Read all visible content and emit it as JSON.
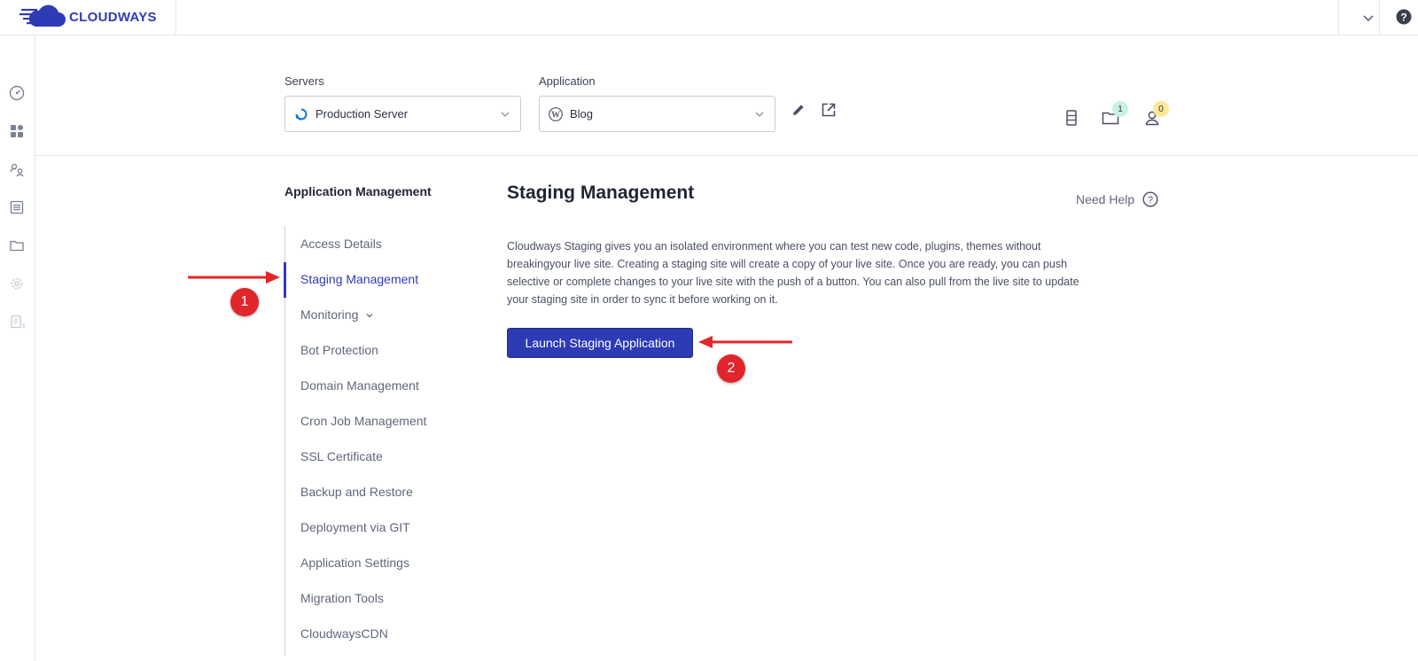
{
  "brand": {
    "name": "CLOUDWAYS"
  },
  "colors": {
    "accent": "#2d3bb5",
    "annotation": "#e0262b"
  },
  "selectors": {
    "servers_label": "Servers",
    "server_value": "Production Server",
    "application_label": "Application",
    "application_value": "Blog"
  },
  "header_icons": {
    "server_count": "",
    "folder_badge": "1",
    "user_badge": "0"
  },
  "sidebar": {
    "title": "Application Management",
    "items": [
      {
        "label": "Access Details"
      },
      {
        "label": "Staging Management"
      },
      {
        "label": "Monitoring"
      },
      {
        "label": "Bot Protection"
      },
      {
        "label": "Domain Management"
      },
      {
        "label": "Cron Job Management"
      },
      {
        "label": "SSL Certificate"
      },
      {
        "label": "Backup and Restore"
      },
      {
        "label": "Deployment via GIT"
      },
      {
        "label": "Application Settings"
      },
      {
        "label": "Migration Tools"
      },
      {
        "label": "CloudwaysCDN"
      }
    ],
    "active_item": "Staging Management"
  },
  "main": {
    "title": "Staging Management",
    "need_help": "Need Help",
    "description": "Cloudways Staging gives you an isolated environment where you can test new code, plugins, themes without breakingyour live site. Creating a staging site will create a copy of your live site. Once you are ready, you can push selective or complete changes to your live site with the push of a button. You can also pull from the live site to update your staging site in order to sync it before working on it.",
    "launch_button": "Launch Staging Application"
  },
  "annotations": {
    "step1": "1",
    "step2": "2"
  }
}
